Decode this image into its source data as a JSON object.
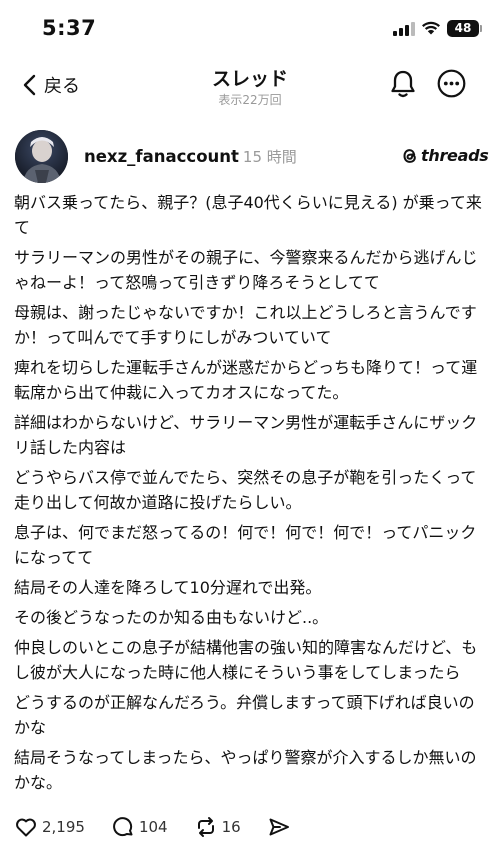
{
  "status_bar": {
    "time": "5:37",
    "battery": "48"
  },
  "header": {
    "back_label": "戻る",
    "title": "スレッド",
    "views": "表示22万回"
  },
  "post": {
    "username": "nexz_fanaccount",
    "time": "15 時間",
    "brand": "threads",
    "paragraphs": [
      "朝バス乗ってたら、親子？(息子40代くらいに見える) が乗って来て",
      "サラリーマンの男性がその親子に、今警察来るんだから逃げんじゃねーよ！って怒鳴って引きずり降ろそうとしてて",
      "母親は、謝ったじゃないですか！これ以上どうしろと言うんですか！って叫んでて手すりにしがみついていて",
      "痺れを切らした運転手さんが迷惑だからどっちも降りて！って運転席から出て仲裁に入ってカオスになってた。",
      "詳細はわからないけど、サラリーマン男性が運転手さんにザックリ話した内容は",
      "どうやらバス停で並んでたら、突然その息子が鞄を引ったくって走り出して何故か道路に投げたらしい。",
      "息子は、何でまだ怒ってるの！何で！何で！何で！ってパニックになってて",
      "結局その人達を降ろして10分遅れで出発。",
      "その後どうなったのか知る由もないけど..。",
      "仲良しのいとこの息子が結構他害の強い知的障害なんだけど、もし彼が大人になった時に他人様にそういう事をしてしまったら",
      "どうするのが正解なんだろう。弁償しますって頭下げれば良いのかな",
      "結局そうなってしまったら、やっぱり警察が介入するしか無いのかな。"
    ],
    "likes": "2,195",
    "replies": "104",
    "reposts": "16"
  },
  "icons": {
    "back": "chevron-left-icon",
    "bell": "bell-icon",
    "more": "more-icon",
    "like": "heart-icon",
    "reply": "comment-icon",
    "repost": "repost-icon",
    "share": "send-icon"
  },
  "colors": {
    "text": "#111111",
    "muted": "#999999",
    "background": "#ffffff"
  }
}
